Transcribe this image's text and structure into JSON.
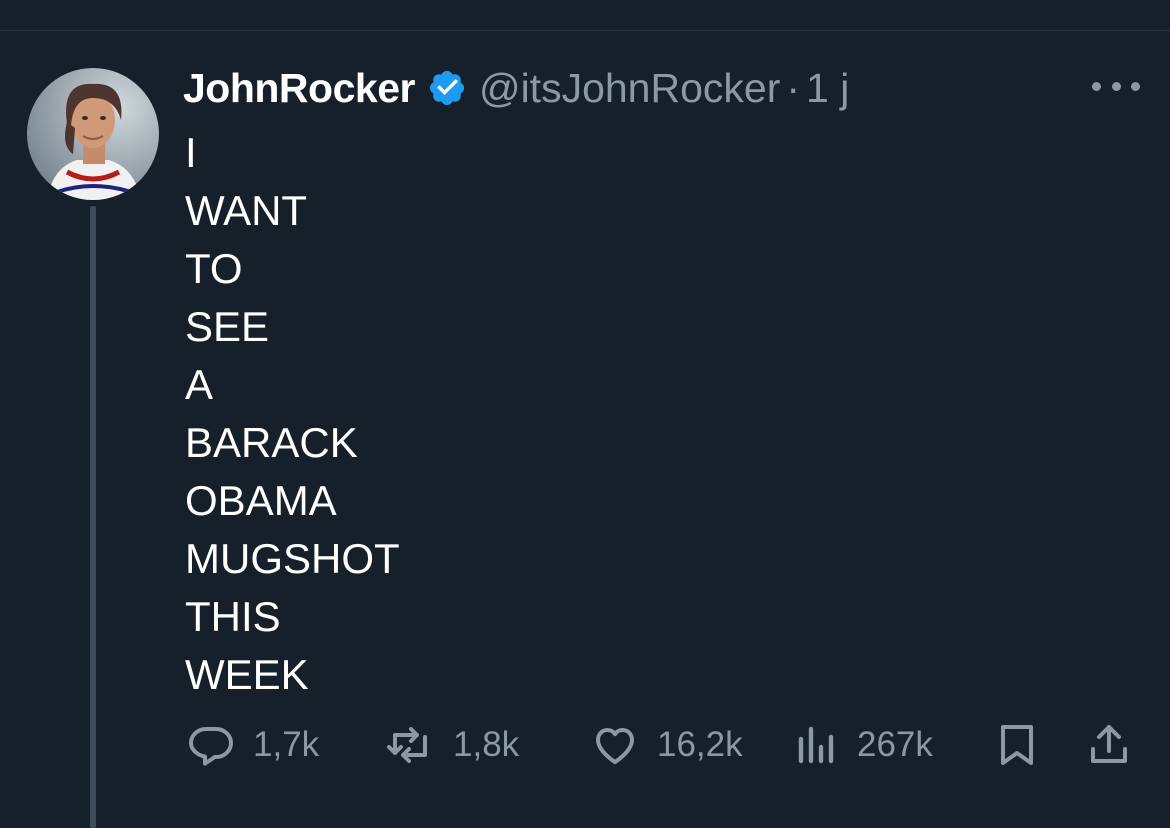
{
  "tweet": {
    "display_name": "JohnRocker",
    "handle": "@itsJohnRocker",
    "separator": "·",
    "time": "1 j",
    "verified": true,
    "text_lines": [
      "I",
      "WANT",
      "TO",
      "SEE",
      "A",
      "BARACK",
      "OBAMA",
      "MUGSHOT",
      "THIS",
      "WEEK"
    ]
  },
  "actions": {
    "replies": "1,7k",
    "reposts": "1,8k",
    "likes": "16,2k",
    "views": "267k"
  },
  "icons": {
    "verified": "verified-badge-icon",
    "more": "more-icon",
    "reply": "reply-icon",
    "repost": "repost-icon",
    "like": "heart-icon",
    "views": "views-icon",
    "bookmark": "bookmark-icon",
    "share": "share-icon"
  },
  "colors": {
    "background": "#15202b",
    "text": "#ffffff",
    "secondary": "#8b98a5",
    "verified": "#1d9bf0"
  }
}
